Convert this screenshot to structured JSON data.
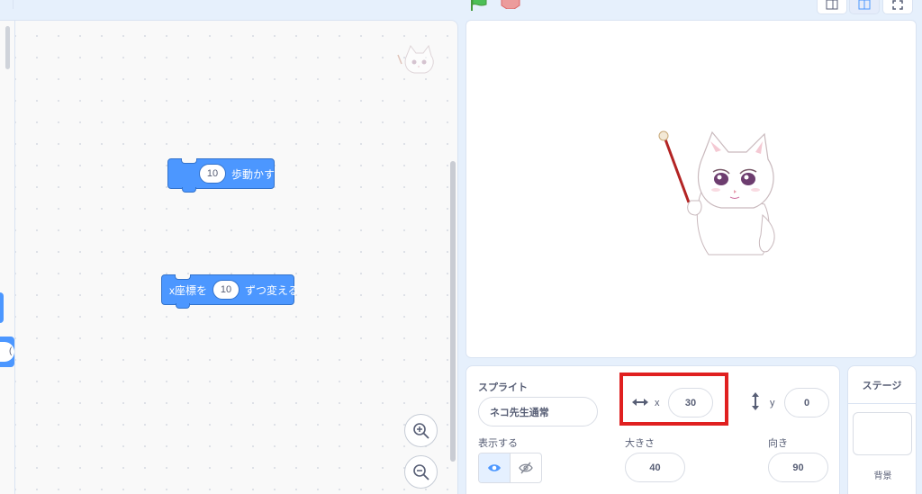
{
  "toolbar": {
    "flag_icon": "green-flag-icon",
    "stop_icon": "stop-icon",
    "view_modes": [
      "small-stage-icon",
      "normal-stage-icon",
      "fullscreen-icon"
    ]
  },
  "code_area": {
    "blocks": [
      {
        "value": "10",
        "text": "歩動かす"
      },
      {
        "prefix": "x座標を",
        "value": "10",
        "text": "ずつ変える"
      }
    ],
    "edge_slot_value": "(",
    "zoom_in_icon": "zoom-in-icon",
    "zoom_out_icon": "zoom-out-icon"
  },
  "sprite_info": {
    "sprite_label": "スプライト",
    "sprite_name": "ネコ先生通常",
    "x_label": "x",
    "x_value": "30",
    "y_label": "y",
    "y_value": "0",
    "show_label": "表示する",
    "size_label": "大きさ",
    "size_value": "40",
    "direction_label": "向き",
    "direction_value": "90"
  },
  "stage_pane": {
    "title": "ステージ",
    "backdrop_label": "背景"
  },
  "colors": {
    "motion_block": "#4c97ff",
    "highlight": "#e02020"
  }
}
